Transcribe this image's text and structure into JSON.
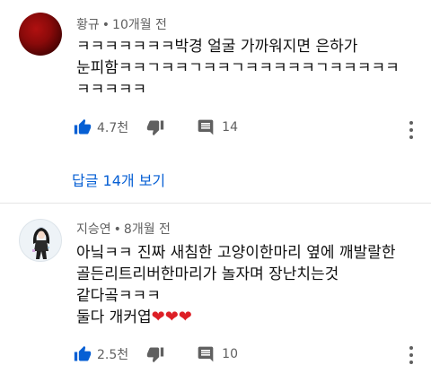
{
  "comments": [
    {
      "author": "황규",
      "age": "10개월 전",
      "lines": [
        "ㅋㅋㅋㅋㅋㅋㅋ박경 얼굴 가까워지면 은하가",
        "눈피함ㅋㅋㄱㅋㅋㄱㅋㅋㄱㅋㅋㅋㅋㅋㄱㅋㅋㅋㅋㅋ",
        "ㅋㅋㅋㅋㅋ"
      ],
      "likes": "4.7천",
      "replies_count": "14",
      "replies_link": "답글 14개 보기"
    },
    {
      "author": "지승연",
      "age": "8개월 전",
      "lines": [
        "아닠ㅋㅋ 진짜 새침한 고양이한마리 옆에 깨발랄한",
        "골든리트리버한마리가 놀자며 장난치는것",
        "같다곸ㅋㅋㅋ",
        "둘다 개커엽"
      ],
      "hearts": "❤❤❤",
      "likes": "2.5천",
      "replies_count": "10"
    }
  ],
  "separator": "•",
  "colors": {
    "accent_blue": "#065fd4",
    "meta_gray": "#606060",
    "heart_red": "#dd1f26"
  },
  "icons": {
    "like": "thumbs-up-filled-icon",
    "dislike": "thumbs-down-icon",
    "reply": "comment-icon",
    "menu": "more-vertical-icon"
  }
}
